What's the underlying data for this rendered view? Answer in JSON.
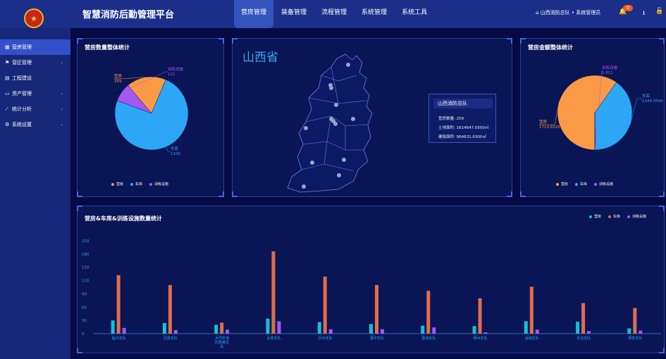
{
  "app": {
    "title": "智慧消防后勤管理平台",
    "logo_glyph": "★"
  },
  "topnav": [
    "营房管理",
    "装备管理",
    "流程管理",
    "系统管理",
    "系统工具"
  ],
  "user": {
    "text": "山西消防总队 • 系统管理员",
    "badge": "0"
  },
  "sidebar": [
    {
      "label": "营房管理",
      "icon": "building-icon",
      "glyph": "▦",
      "chevron": false
    },
    {
      "label": "营区管理",
      "icon": "flag-icon",
      "glyph": "⚑",
      "chevron": true
    },
    {
      "label": "工程建设",
      "icon": "grid-icon",
      "glyph": "▤",
      "chevron": false
    },
    {
      "label": "资产管理",
      "icon": "monitor-icon",
      "glyph": "▭",
      "chevron": true
    },
    {
      "label": "统计分析",
      "icon": "chart-icon",
      "glyph": "⟋",
      "chevron": true
    },
    {
      "label": "系统设置",
      "icon": "gear-icon",
      "glyph": "⚙",
      "chevron": true
    }
  ],
  "panels": {
    "count_title": "营房数量整体统计",
    "amount_title": "营房金额整体统计",
    "bar_title": "营房&车库&训练设施数量统计"
  },
  "map": {
    "province": "山西省",
    "info_title": "山西消防总队",
    "lines": [
      "营房数量: 259",
      "土地面积: 1614647.0500㎡",
      "建筑面积: 964631.6300㎡"
    ]
  },
  "colors": {
    "orange": "#fb9a46",
    "blue": "#2ea6f6",
    "purple": "#a458f2",
    "bar_cyan": "#15c0d5",
    "bar_orange": "#e06d4b",
    "bar_purple": "#a458f2"
  },
  "chart_data": [
    {
      "type": "pie",
      "labels": [
        "营房",
        "车库",
        "训练设施"
      ],
      "values": [
        259,
        1100,
        121
      ],
      "legend": [
        "营房",
        "车库",
        "训练设施"
      ]
    },
    {
      "type": "pie",
      "labels": [
        "营房",
        "车库",
        "训练设施"
      ],
      "values": [
        1713.6525,
        1144.0508,
        5.811
      ],
      "value_labels": [
        "1713.6525",
        "1144.0508",
        "5.811"
      ],
      "legend": [
        "营房",
        "车库",
        "训练设施"
      ]
    },
    {
      "type": "bar",
      "categories": [
        "临汾支队",
        "吕梁支队",
        "大同市消防救援支队",
        "太原支队",
        "忻州支队",
        "晋中支队",
        "晋城支队",
        "朔州支队",
        "运城支队",
        "长治支队",
        "阳泉支队"
      ],
      "series": [
        {
          "name": "营房",
          "values": [
            30,
            24,
            20,
            34,
            26,
            22,
            18,
            17,
            28,
            27,
            12
          ]
        },
        {
          "name": "车库",
          "values": [
            132,
            110,
            25,
            186,
            129,
            110,
            97,
            80,
            106,
            69,
            58
          ]
        },
        {
          "name": "训练设施",
          "values": [
            13,
            8,
            9,
            28,
            10,
            10,
            14,
            3,
            9,
            6,
            7
          ]
        }
      ],
      "yticks": [
        0,
        30,
        60,
        90,
        120,
        150,
        180,
        210
      ],
      "ylim": [
        0,
        210
      ]
    }
  ]
}
